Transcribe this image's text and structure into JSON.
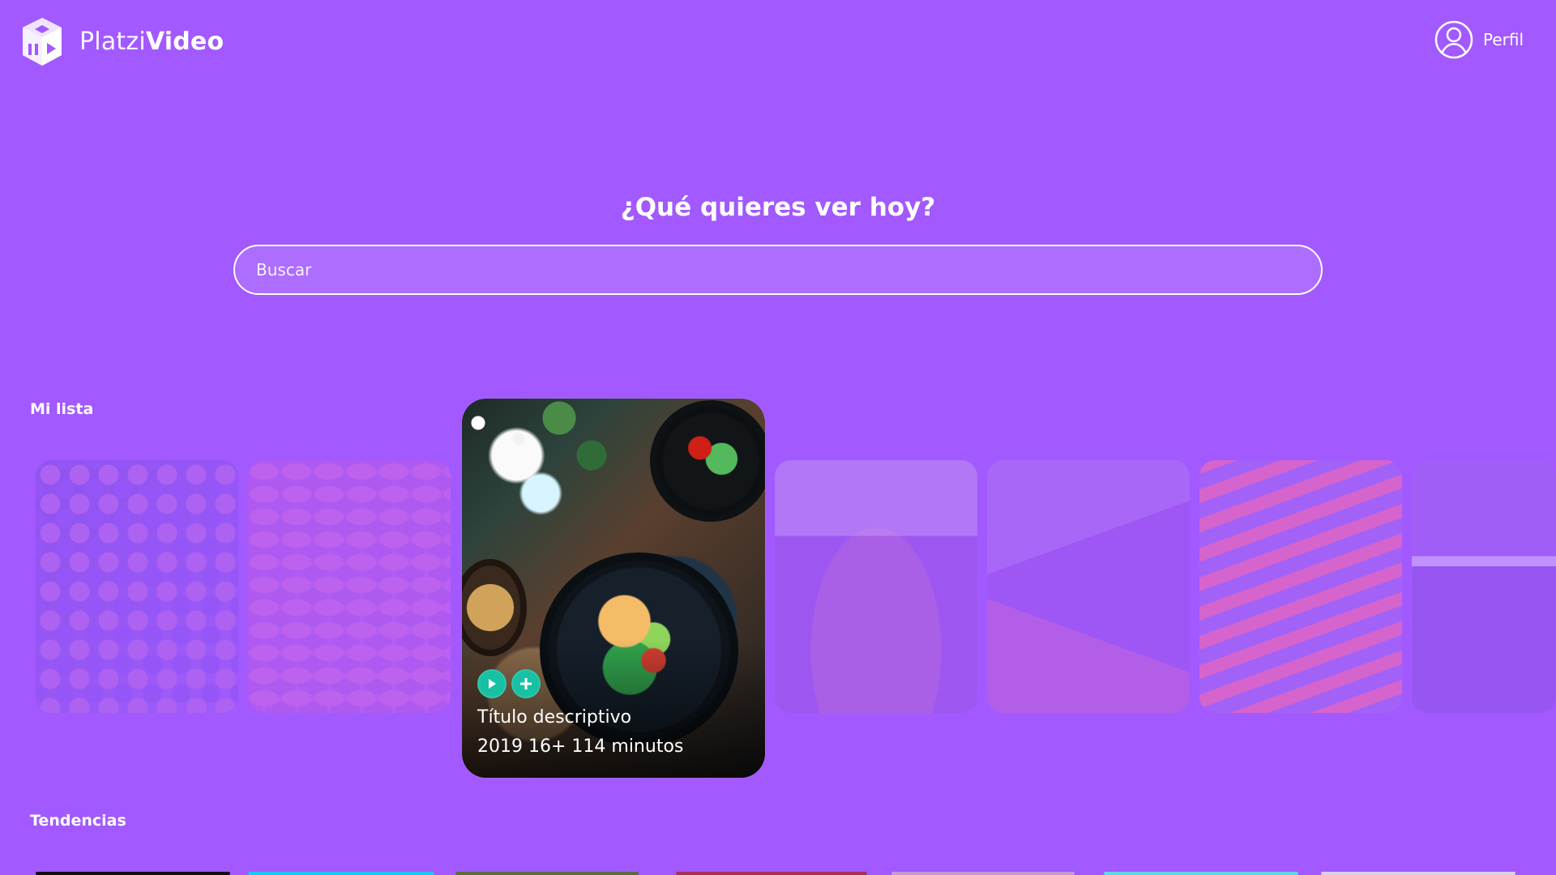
{
  "brand": {
    "name_light": "Platzi",
    "name_bold": "Video",
    "logo_icon": "cube-play-icon"
  },
  "header": {
    "profile_label": "Perfil",
    "profile_icon": "user-avatar-icon"
  },
  "hero": {
    "title": "¿Qué quieres ver hoy?"
  },
  "search": {
    "placeholder": "Buscar",
    "value": ""
  },
  "sections": {
    "my_list_title": "Mi lista",
    "trends_title": "Tendencias"
  },
  "my_list": {
    "featured": {
      "title": "Título descriptivo",
      "meta": "2019 16+ 114 minutos",
      "play_icon": "play-icon",
      "add_icon": "plus-icon"
    }
  },
  "colors": {
    "background": "#a259ff",
    "accent": "#18c1a4",
    "text": "#ffffff"
  }
}
